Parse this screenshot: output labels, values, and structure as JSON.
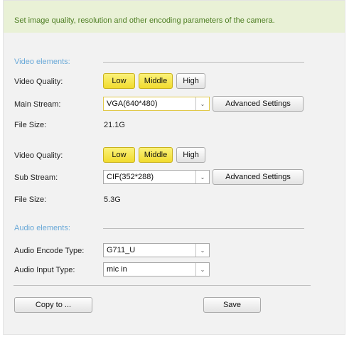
{
  "banner": {
    "text": "Set image quality, resolution and other encoding parameters of the camera."
  },
  "video": {
    "section_label": "Video elements:",
    "main": {
      "quality_label": "Video Quality:",
      "quality_options": [
        "Low",
        "Middle",
        "High"
      ],
      "quality_highlighted": [
        "Low",
        "Middle"
      ],
      "stream_label": "Main Stream:",
      "stream_value": "VGA(640*480)",
      "advanced_label": "Advanced Settings",
      "filesize_label": "File Size:",
      "filesize_value": "21.1G"
    },
    "sub": {
      "quality_label": "Video Quality:",
      "quality_options": [
        "Low",
        "Middle",
        "High"
      ],
      "quality_highlighted": [
        "Low",
        "Middle"
      ],
      "stream_label": "Sub Stream:",
      "stream_value": "CIF(352*288)",
      "advanced_label": "Advanced Settings",
      "filesize_label": "File Size:",
      "filesize_value": "5.3G"
    }
  },
  "audio": {
    "section_label": "Audio elements:",
    "encode_label": "Audio Encode Type:",
    "encode_value": "G711_U",
    "input_label": "Audio Input Type:",
    "input_value": "mic in"
  },
  "footer": {
    "copy_label": "Copy to ...",
    "save_label": "Save"
  },
  "colors": {
    "banner_bg": "#e9f1d6",
    "banner_text": "#4f7f24",
    "section_text": "#6aa9d8",
    "highlight_button": "#f1db2e"
  },
  "icons": {
    "dropdown": "chevron-down-icon"
  }
}
